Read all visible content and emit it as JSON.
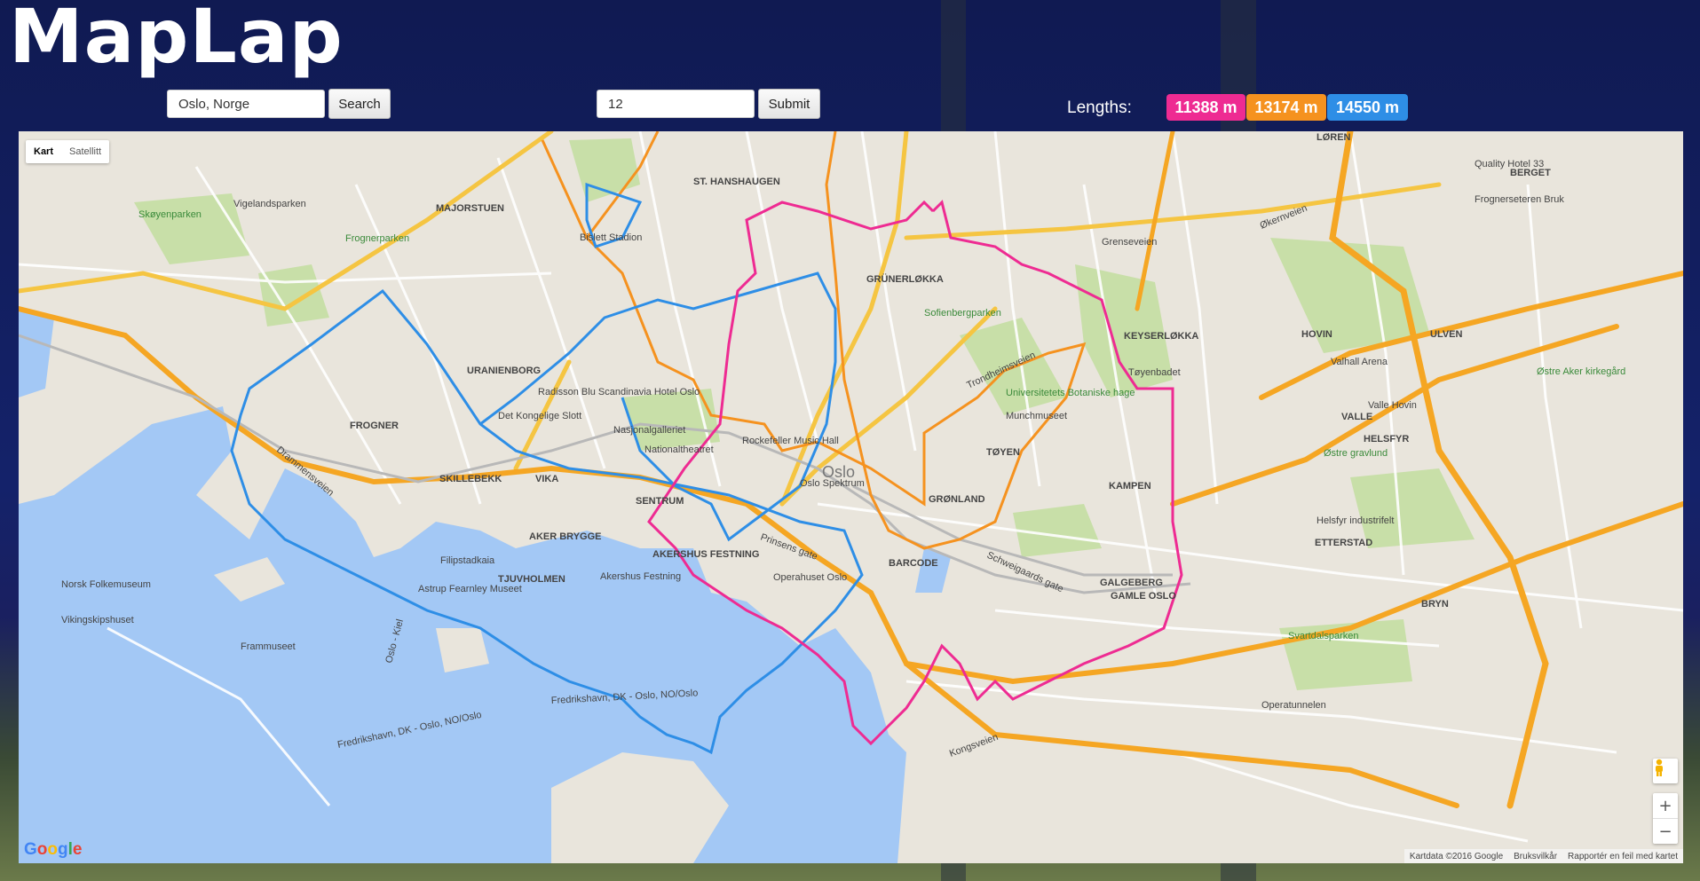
{
  "app": {
    "title": "MapLap"
  },
  "search": {
    "value": "Oslo, Norge",
    "button_label": "Search"
  },
  "count": {
    "value": "12",
    "button_label": "Submit"
  },
  "lengths": {
    "label": "Lengths:",
    "badges": [
      {
        "text": "11388 m",
        "color": "#ee2b92"
      },
      {
        "text": "13174 m",
        "color": "#f5921f"
      },
      {
        "text": "14550 m",
        "color": "#2e8ee6"
      }
    ]
  },
  "map": {
    "type_controls": {
      "map": "Kart",
      "satellite": "Satellitt"
    },
    "zoom": {
      "in": "+",
      "out": "−"
    },
    "attribution": {
      "data": "Kartdata ©2016 Google",
      "terms": "Bruksvilkår",
      "report": "Rapportér en feil med kartet"
    },
    "logo": "Google",
    "icons": {
      "pegman": "pegman-icon"
    },
    "labels": {
      "majorstuen": "MAJORSTUEN",
      "st_hanshaugen": "ST. HANSHAUGEN",
      "grunerlokka": "GRÜNERLØKKA",
      "frogner": "FROGNER",
      "uranienborg": "URANIENBORG",
      "skillebekk": "SKILLEBEKK",
      "vika": "VIKA",
      "sentrum": "SENTRUM",
      "aker_brygge": "AKER BRYGGE",
      "tjuvholmen": "TJUVHOLMEN",
      "akershus": "AKERSHUS FESTNING",
      "barcode": "BARCODE",
      "gronland": "GRØNLAND",
      "toyen": "TØYEN",
      "kampen": "KAMPEN",
      "galgeberg": "GALGEBERG",
      "gamle_oslo": "GAMLE OSLO",
      "keyserlokka": "KEYSERLØKKA",
      "hovin": "HOVIN",
      "ulven": "ULVEN",
      "vale": "VALLE",
      "helsfyr": "HELSFYR",
      "etterstad": "ETTERSTAD",
      "bryn": "BRYN",
      "loren": "LØREN",
      "berget": "BERGET",
      "oslo": "Oslo",
      "skoyenparken": "Skøyenparken",
      "vigelandsparken": "Vigelandsparken",
      "frognerparken": "Frognerparken",
      "bislett": "Bislett Stadion",
      "radisson": "Radisson Blu Scandinavia Hotel Oslo",
      "slottet": "Det Kongelige Slott",
      "nasjonalgalleriet": "Nasjonalgalleriet",
      "nationaltheatret": "Nationaltheatret",
      "rockefeller": "Rockefeller Music Hall",
      "spektrum": "Oslo Spektrum",
      "operahuset": "Operahuset Oslo",
      "akershus_festning": "Akershus Festning",
      "filipstad": "Filipstadkaia",
      "astrup": "Astrup Fearnley Museet",
      "folkemuseum": "Norsk Folkemuseum",
      "vikingskip": "Vikingskipshuset",
      "frammuseet": "Frammuseet",
      "munchmuseet": "Munchmuseet",
      "botanisk": "Universitetets Botaniske hage",
      "sofienberg": "Sofienbergparken",
      "toyenbadet": "Tøyenbadet",
      "valhall": "Valhall Arena",
      "valle_hovin": "Valle Hovin",
      "ostre_gravlund": "Østre gravlund",
      "helsfyr_ind": "Helsfyr industrifelt",
      "ostre_aker": "Østre Aker kirkegård",
      "quality": "Quality Hotel 33",
      "frognerseteren": "Frognerseteren Bruk",
      "svartdalsparken": "Svartdalsparken",
      "grenseveien": "Grenseveien",
      "okernveien": "Økernveien",
      "operatunnelen": "Operatunnelen",
      "trondheimsveien": "Trondheimsveien",
      "kongsveien": "Kongsveien",
      "schweigaards": "Schweigaards gate",
      "prinsens": "Prinsens gate",
      "drammensveien": "Drammensveien",
      "oslo_kiel": "Oslo - Kiel",
      "fredrikshavn1": "Fredrikshavn, DK - Oslo, NO/Oslo",
      "fredrikshavn2": "Fredrikshavn, DK - Oslo, NO/Oslo"
    }
  }
}
